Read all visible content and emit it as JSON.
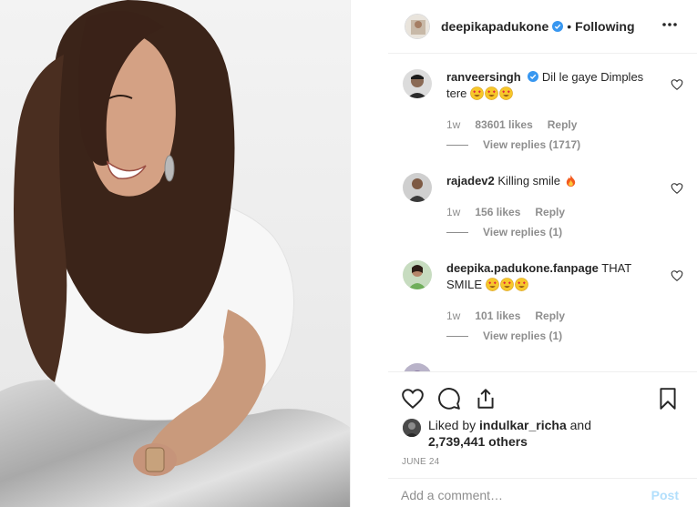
{
  "header": {
    "username": "deepikapadukone",
    "separator": "•",
    "follow_status": "Following",
    "more_icon": "more-horizontal-icon"
  },
  "comments": [
    {
      "username": "ranveersingh",
      "verified": true,
      "text": "Dil le gaye Dimples tere",
      "emojis": [
        "heart-eyes",
        "heart-eyes",
        "heart-eyes"
      ],
      "time": "1w",
      "likes": "83601 likes",
      "reply_label": "Reply",
      "view_replies": "View replies (1717)"
    },
    {
      "username": "rajadev2",
      "verified": false,
      "text": "Killing smile",
      "emojis": [
        "fire"
      ],
      "time": "1w",
      "likes": "156 likes",
      "reply_label": "Reply",
      "view_replies": "View replies (1)"
    },
    {
      "username": "deepika.padukone.fanpage",
      "verified": false,
      "text": "THAT SMILE",
      "emojis": [
        "heart-eyes",
        "heart-eyes",
        "heart-eyes"
      ],
      "time": "1w",
      "likes": "101 likes",
      "reply_label": "Reply",
      "view_replies": "View replies (1)"
    }
  ],
  "actions": {
    "like_icon": "heart-icon",
    "comment_icon": "comment-icon",
    "share_icon": "share-icon",
    "save_icon": "bookmark-icon"
  },
  "likes_summary": {
    "prefix": "Liked by ",
    "user": "indulkar_richa",
    "middle": " and",
    "count": "2,739,441 others"
  },
  "date": "JUNE 24",
  "add_comment": {
    "placeholder": "Add a comment…",
    "post_label": "Post"
  },
  "colors": {
    "text": "#262626",
    "muted": "#8e8e8e",
    "verified": "#3897f0",
    "post_disabled": "#b2dffc"
  }
}
